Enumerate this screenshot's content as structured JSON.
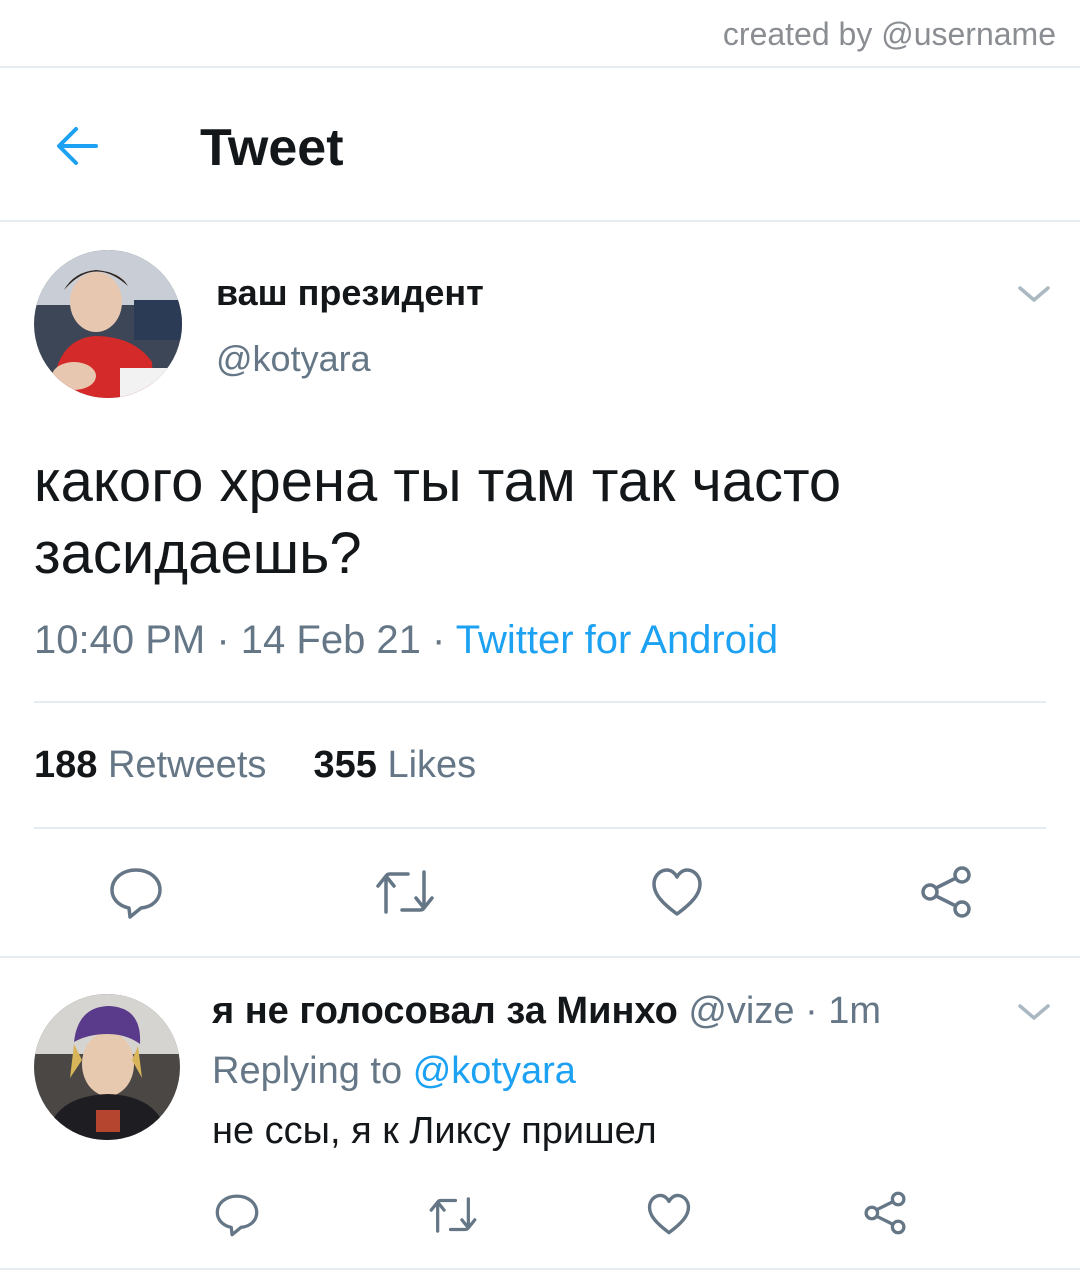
{
  "watermark": "created by @username",
  "header": {
    "title": "Tweet"
  },
  "tweet": {
    "author_name": "ваш президент",
    "author_handle": "@kotyara",
    "text": "какого хрена ты там так часто засидаешь?",
    "time": "10:40 PM",
    "date": "14 Feb 21",
    "source": "Twitter for Android",
    "retweets_count": "188",
    "retweets_label": "Retweets",
    "likes_count": "355",
    "likes_label": "Likes"
  },
  "reply": {
    "author_name": "я не голосовал за Минхо",
    "author_handle": "@vize",
    "time": "1m",
    "replying_prefix": "Replying to",
    "replying_to": "@kotyara",
    "text": "не ссы, я к Ликсу пришел"
  },
  "icons": [
    "back-arrow-icon",
    "chevron-down-icon",
    "reply-icon",
    "retweet-icon",
    "like-icon",
    "share-icon"
  ],
  "colors": {
    "accent": "#1da1f2",
    "secondary_text": "#657786",
    "icon_gray": "#657786",
    "divider": "#e6ecf0"
  }
}
